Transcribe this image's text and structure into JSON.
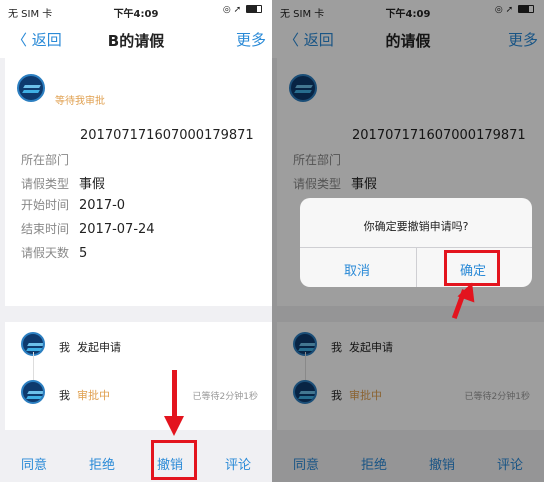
{
  "left": {
    "status": {
      "carrier": "无 SIM 卡",
      "time": "下午4:09"
    },
    "nav": {
      "back": "〈 返回",
      "title": "B的请假",
      "more": "更多"
    },
    "status_line": "等待我审批",
    "form_no": "20170717160700017987​1",
    "rows": [
      {
        "label": "所在部门",
        "value": ""
      },
      {
        "label": "请假类型",
        "value": "事假"
      },
      {
        "label": "开始时间",
        "value": "2017-0"
      },
      {
        "label": "结束时间",
        "value": "2017-07-24"
      },
      {
        "label": "请假天数",
        "value": "5"
      }
    ],
    "timeline": [
      {
        "actor": "我",
        "action": "发起申请",
        "wait": ""
      },
      {
        "actor": "我",
        "action": "审批中",
        "wait": "已等待2分钟1秒"
      }
    ],
    "actions": [
      "同意",
      "拒绝",
      "撤销",
      "评论"
    ]
  },
  "right": {
    "status": {
      "carrier": "无 SIM 卡",
      "time": "下午4:09"
    },
    "nav": {
      "back": "〈 返回",
      "title": "的请假",
      "more": "更多"
    },
    "form_no": "20170717160700017987​1",
    "rows": [
      {
        "label": "所在部门",
        "value": ""
      },
      {
        "label": "请假类型",
        "value": "事假"
      }
    ],
    "dialog": {
      "message": "你确定要撤销申请吗?",
      "cancel": "取消",
      "confirm": "确定"
    },
    "timeline": [
      {
        "actor": "我",
        "action": "发起申请",
        "wait": ""
      },
      {
        "actor": "我",
        "action": "审批中",
        "wait": "已等待2分钟1秒"
      }
    ],
    "actions": [
      "同意",
      "拒绝",
      "撤销",
      "评论"
    ]
  },
  "colors": {
    "accent": "#2a8ad7",
    "highlight": "#e3141e",
    "pending": "#e0a050"
  }
}
